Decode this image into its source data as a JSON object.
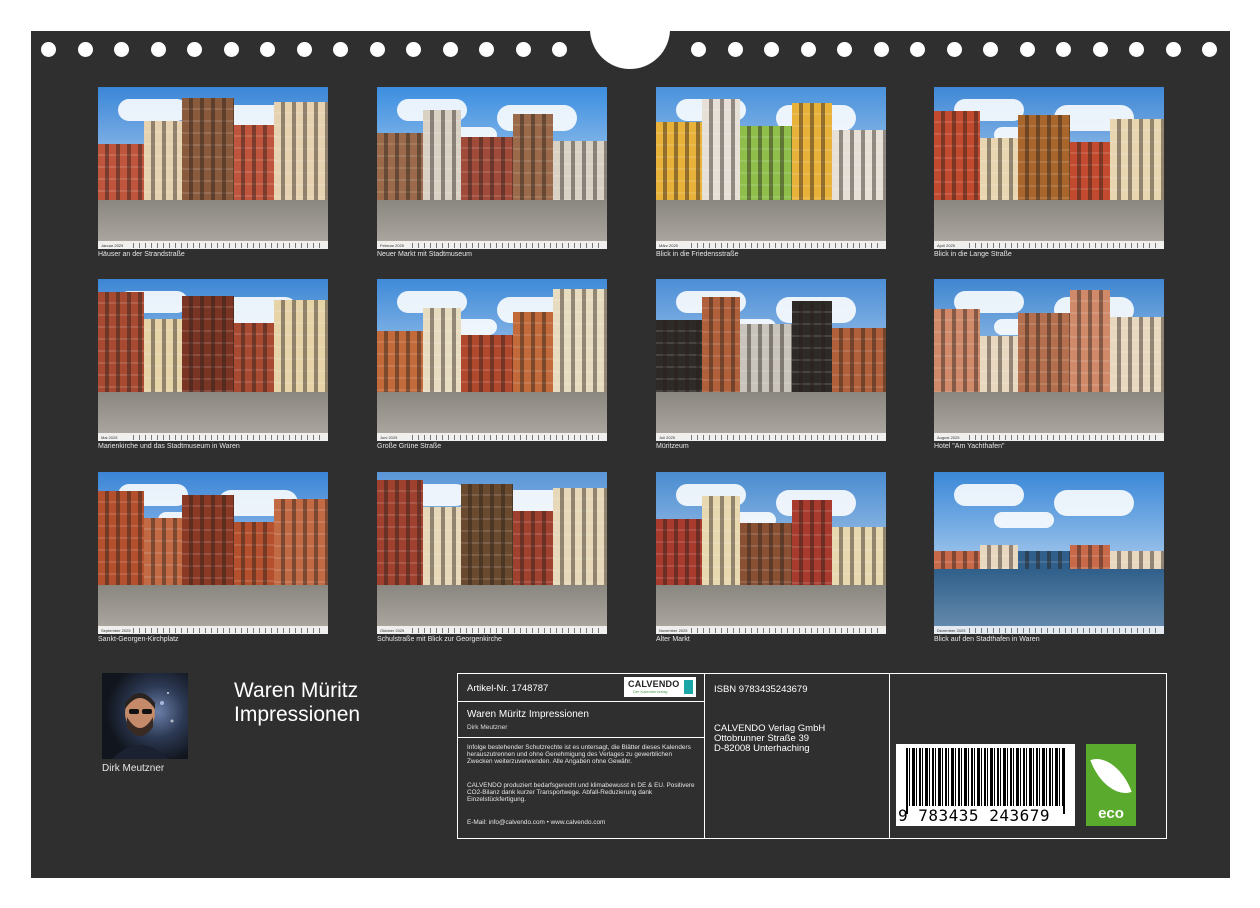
{
  "photos": [
    {
      "month": "Januar 2025",
      "caption": "Häuser an der Strandstraße",
      "sky": "#3a86d8"
    },
    {
      "month": "Februar 2025",
      "caption": "Neuer Markt mit Stadtmuseum",
      "sky": "#3c8ee0"
    },
    {
      "month": "März 2025",
      "caption": "Blick in die Friedensstraße",
      "sky": "#4a92dc"
    },
    {
      "month": "April 2025",
      "caption": "Blick in die Lange Straße",
      "sky": "#3f88d6"
    },
    {
      "month": "Mai 2025",
      "caption": "Marienkirche und das Stadtmuseum  in Waren",
      "sky": "#3c86d4"
    },
    {
      "month": "Juni 2025",
      "caption": "Große Grüne Straße",
      "sky": "#3f8ad8"
    },
    {
      "month": "Juli 2025",
      "caption": "Müritzeum",
      "sky": "#4c8ed6"
    },
    {
      "month": "August 2025",
      "caption": "Hotel \"Am Yachthafen\"",
      "sky": "#3f86d0"
    },
    {
      "month": "September 2025",
      "caption": "Sankt-Georgen-Kirchplatz",
      "sky": "#3a84d6"
    },
    {
      "month": "Oktober 2025",
      "caption": "Schulstraße mit Blick zur Georgenkirche",
      "sky": "#5a96d8"
    },
    {
      "month": "November 2025",
      "caption": "Alter Markt",
      "sky": "#4a8cd0"
    },
    {
      "month": "Dezember 2025",
      "caption": "Blick auf den Stadthafen in Waren",
      "sky": "#3a88d8"
    }
  ],
  "author": {
    "name": "Dirk Meutzner"
  },
  "title": {
    "line1": "Waren Müritz",
    "line2": "Impressionen"
  },
  "info": {
    "article": "Artikel-Nr. 1748787",
    "logo_name": "CALVENDO",
    "logo_tag": "Der Kalenderverlag",
    "product_title": "Waren Müritz Impressionen",
    "product_author": "Dirk Meutzner",
    "legal": "Infolge bestehender Schutzrechte ist es untersagt, die Blätter dieses Kalenders herauszutrennen und ohne Genehmigung des Verlages zu gewerblichen Zwecken weiterzuverwenden. Alle Angaben ohne Gewähr.",
    "eco_note": "CALVENDO produziert bedarfsgerecht und klimabewusst in DE & EU. Positivere CO2-Bilanz dank kurzer Transportwege. Abfall-Reduzierung dank Einzelstückfertigung.",
    "contact": "E-Mail: info@calvendo.com • www.calvendo.com",
    "isbn": "ISBN 9783435243679",
    "publisher_name": "CALVENDO Verlag GmbH",
    "publisher_street": "Ottobrunner Straße 39",
    "publisher_city": "D-82008 Unterhaching",
    "barcode_digits": "9 783435 243679",
    "eco_label": "eco"
  },
  "colors": {
    "sheet": "#2f2f2f",
    "eco_green": "#5aab2d",
    "brick": "#b5533a",
    "plaster": "#e8d8b8"
  }
}
